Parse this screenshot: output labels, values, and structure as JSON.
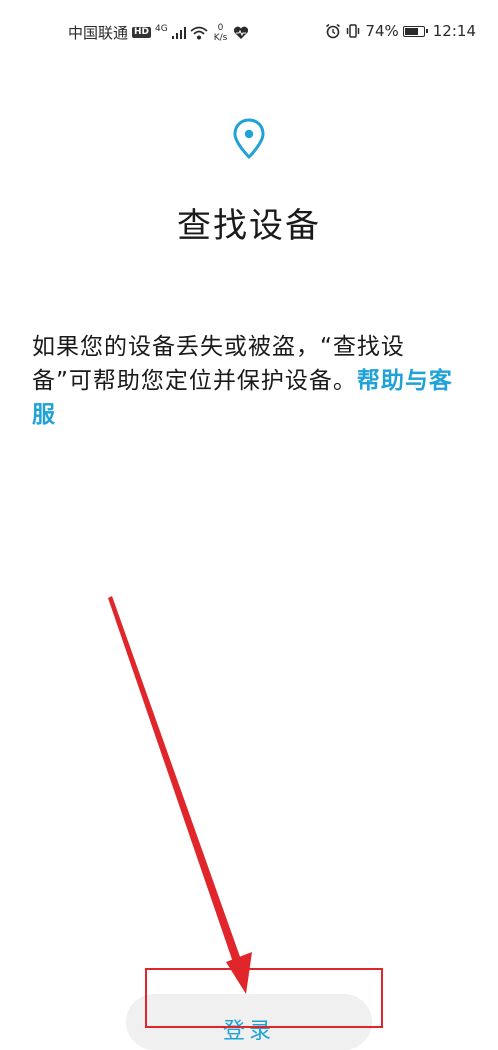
{
  "status_bar": {
    "carrier": "中国联通",
    "hd_badge": "HD",
    "network_type": "4G",
    "speed_value": "0",
    "speed_unit": "K/s",
    "battery_percent": "74%",
    "battery_level": 0.74,
    "time": "12:14"
  },
  "main": {
    "title": "查找设备",
    "description": "如果您的设备丢失或被盗，“查找设备”可帮助您定位并保护设备。",
    "help_link": "帮助与客服",
    "login_button": "登录"
  },
  "colors": {
    "accent": "#1ea2d8",
    "annotation": "#e0262b"
  },
  "icons": {
    "status_left": [
      "wifi-icon",
      "signal-icon",
      "heart-icon"
    ],
    "status_right": [
      "alarm-icon",
      "vibrate-icon",
      "battery-icon"
    ],
    "main": "location-pin-icon"
  }
}
